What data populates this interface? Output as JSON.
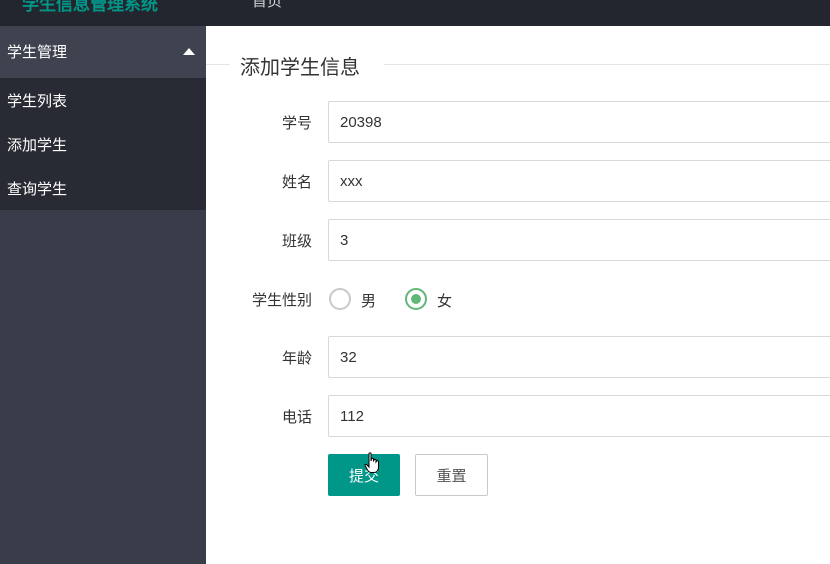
{
  "topbar": {
    "brand": "学生信息管理系统",
    "nav_item": "首页"
  },
  "sidebar": {
    "group_title": "学生管理",
    "items": [
      {
        "label": "学生列表"
      },
      {
        "label": "添加学生"
      },
      {
        "label": "查询学生"
      }
    ]
  },
  "form": {
    "title": "添加学生信息",
    "fields": {
      "student_id": {
        "label": "学号",
        "value": "20398"
      },
      "name": {
        "label": "姓名",
        "value": "xxx"
      },
      "class": {
        "label": "班级",
        "value": "3"
      },
      "gender": {
        "label": "学生性别",
        "options": [
          "男",
          "女"
        ],
        "selected": "女"
      },
      "age": {
        "label": "年龄",
        "value": "32"
      },
      "phone": {
        "label": "电话",
        "value": "112"
      }
    },
    "submit_label": "提交",
    "reset_label": "重置"
  },
  "colors": {
    "topbar": "#23262e",
    "sidebar": "#393d49",
    "sidebar_sub": "#282b33",
    "accent": "#009688",
    "radio_checked": "#5fb878"
  }
}
